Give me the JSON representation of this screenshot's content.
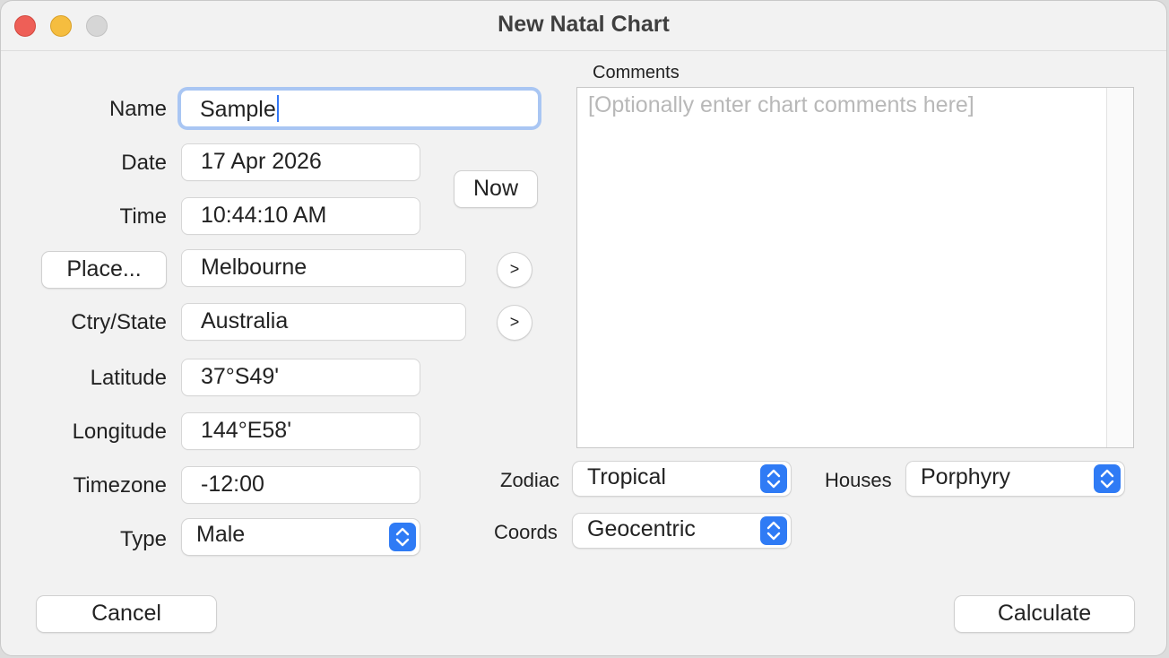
{
  "window": {
    "title": "New Natal Chart",
    "controls": [
      "close",
      "minimize",
      "zoom"
    ]
  },
  "form": {
    "name": {
      "label": "Name",
      "value": "Sample"
    },
    "date": {
      "label": "Date",
      "value": "17 Apr 2026"
    },
    "time": {
      "label": "Time",
      "value": "10:44:10 AM"
    },
    "now_button": "Now",
    "place": {
      "button_label": "Place...",
      "value": "Melbourne",
      "next_label": ">"
    },
    "country": {
      "label": "Ctry/State",
      "value": "Australia",
      "next_label": ">"
    },
    "latitude": {
      "label": "Latitude",
      "value": "37°S49'"
    },
    "longitude": {
      "label": "Longitude",
      "value": "144°E58'"
    },
    "timezone": {
      "label": "Timezone",
      "value": "-12:00"
    },
    "type": {
      "label": "Type",
      "value": "Male"
    }
  },
  "comments": {
    "label": "Comments",
    "placeholder": "[Optionally enter chart comments here]"
  },
  "options": {
    "zodiac": {
      "label": "Zodiac",
      "value": "Tropical"
    },
    "houses": {
      "label": "Houses",
      "value": "Porphyry"
    },
    "coords": {
      "label": "Coords",
      "value": "Geocentric"
    }
  },
  "footer": {
    "cancel": "Cancel",
    "calculate": "Calculate"
  },
  "colors": {
    "accent": "#2f7bf5",
    "focus_ring": "#a9c6f3",
    "close": "#ee5f57",
    "minimize": "#f5bd3f",
    "zoom": "#d6d6d6"
  }
}
